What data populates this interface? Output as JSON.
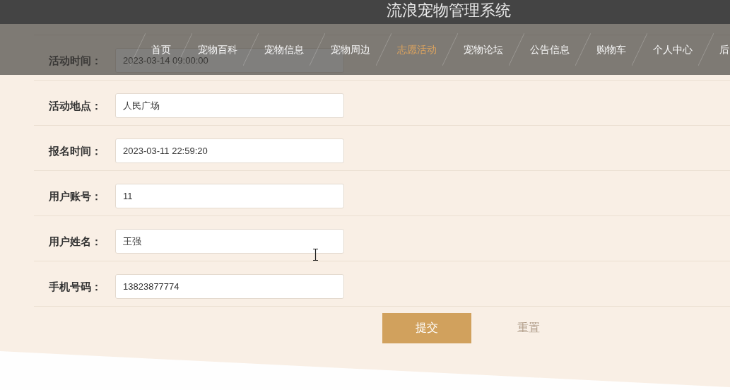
{
  "header": {
    "title": "流浪宠物管理系统"
  },
  "nav": {
    "items": [
      {
        "label": "首页",
        "selected": false
      },
      {
        "label": "宠物百科",
        "selected": false
      },
      {
        "label": "宠物信息",
        "selected": false
      },
      {
        "label": "宠物周边",
        "selected": false
      },
      {
        "label": "志愿活动",
        "selected": true
      },
      {
        "label": "宠物论坛",
        "selected": false
      },
      {
        "label": "公告信息",
        "selected": false
      },
      {
        "label": "购物车",
        "selected": false
      },
      {
        "label": "个人中心",
        "selected": false
      },
      {
        "label": "后",
        "selected": false
      }
    ]
  },
  "form": {
    "fields": [
      {
        "label": "活动时间：",
        "value": "2023-03-14 09:00:00"
      },
      {
        "label": "活动地点：",
        "value": "人民广场"
      },
      {
        "label": "报名时间：",
        "value": "2023-03-11 22:59:20"
      },
      {
        "label": "用户账号：",
        "value": "11"
      },
      {
        "label": "用户姓名：",
        "value": "王强"
      },
      {
        "label": "手机号码：",
        "value": "13823877774"
      }
    ]
  },
  "buttons": [
    {
      "label": "提交",
      "kind": "submit"
    },
    {
      "label": "重置",
      "kind": "reset"
    }
  ]
}
